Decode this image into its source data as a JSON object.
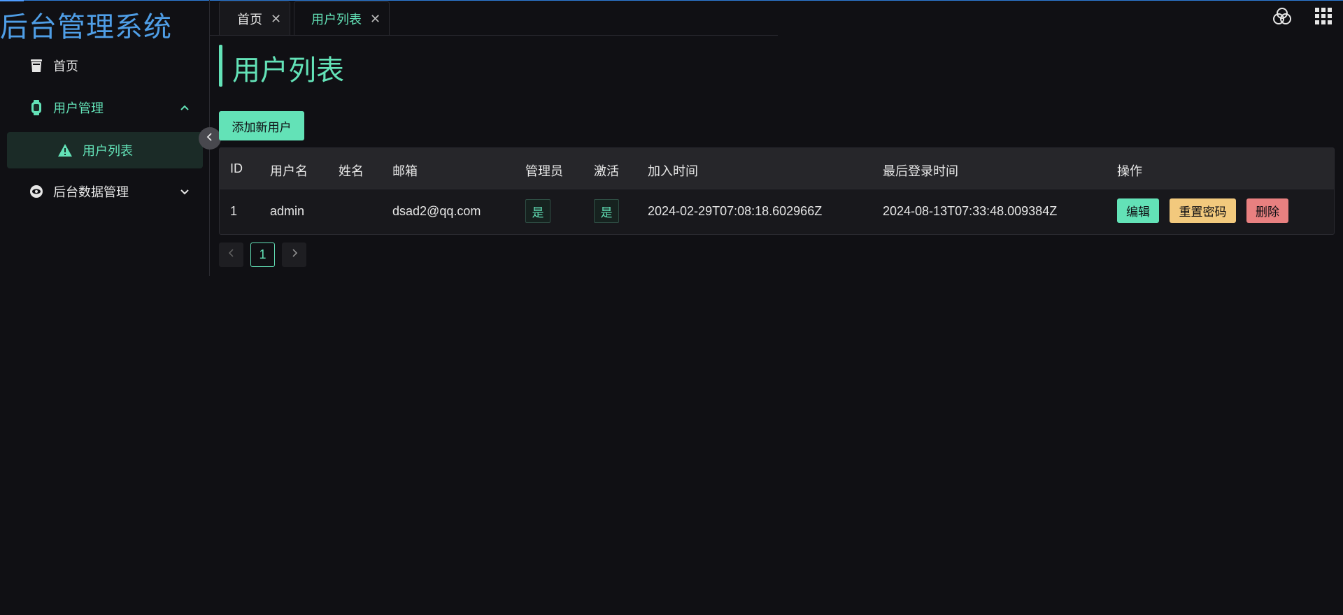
{
  "app": {
    "title": "后台管理系统"
  },
  "sidebar": {
    "items": [
      {
        "label": "首页",
        "icon": "trash-can-icon"
      },
      {
        "label": "用户管理",
        "icon": "watch-icon",
        "expanded": true,
        "children": [
          {
            "label": "用户列表",
            "icon": "warning-icon",
            "active": true
          }
        ]
      },
      {
        "label": "后台数据管理",
        "icon": "eye-icon",
        "expanded": false
      }
    ]
  },
  "tabs": [
    {
      "label": "首页",
      "active": false
    },
    {
      "label": "用户列表",
      "active": true
    }
  ],
  "header_icons": [
    "theme-circles-icon",
    "apps-grid-icon"
  ],
  "page": {
    "title": "用户列表",
    "add_button": "添加新用户"
  },
  "table": {
    "headers": [
      "ID",
      "用户名",
      "姓名",
      "邮箱",
      "管理员",
      "激活",
      "加入时间",
      "最后登录时间",
      "操作"
    ],
    "rows": [
      {
        "id": "1",
        "username": "admin",
        "name": "",
        "email": "dsad2@qq.com",
        "is_admin": "是",
        "is_active": "是",
        "joined": "2024-02-29T07:08:18.602966Z",
        "last_login": "2024-08-13T07:33:48.009384Z",
        "actions": {
          "edit": "编辑",
          "reset": "重置密码",
          "delete": "删除"
        }
      }
    ]
  },
  "pagination": {
    "current": "1"
  },
  "colors": {
    "accent": "#63e2b7",
    "logo": "#4f9ee6",
    "background": "#101014",
    "warning": "#f2c97d",
    "danger": "#e88080"
  }
}
